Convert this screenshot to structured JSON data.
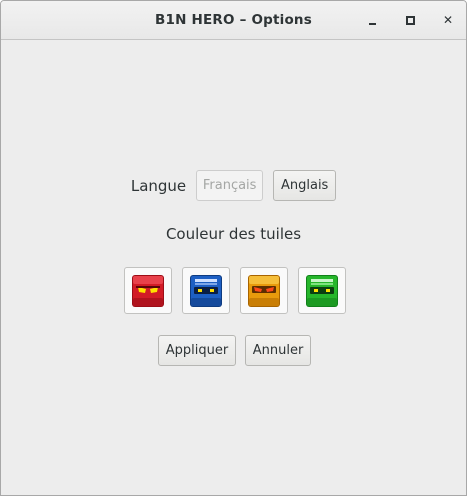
{
  "window": {
    "title": "B1N HERO – Options",
    "controls": {
      "minimize_icon": "minimize-icon",
      "maximize_icon": "maximize-icon",
      "close_icon": "close-icon",
      "close_glyph": "✕"
    }
  },
  "language": {
    "label": "Langue",
    "options": [
      {
        "label": "Français",
        "enabled": false
      },
      {
        "label": "Anglais",
        "enabled": true
      }
    ]
  },
  "tile_color": {
    "label": "Couleur des tuiles",
    "tiles": [
      {
        "name": "red-tile-icon",
        "color": "#d21b26"
      },
      {
        "name": "blue-tile-icon",
        "color": "#1d5fc3"
      },
      {
        "name": "orange-tile-icon",
        "color": "#e89a0c"
      },
      {
        "name": "green-tile-icon",
        "color": "#26b62b"
      }
    ]
  },
  "actions": {
    "apply_label": "Appliquer",
    "cancel_label": "Annuler"
  }
}
